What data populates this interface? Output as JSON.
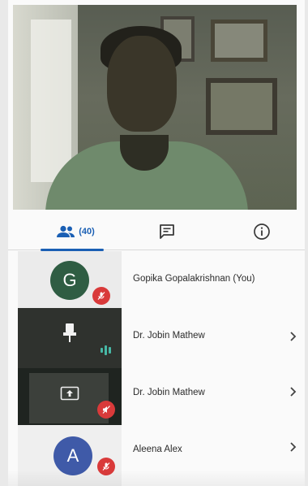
{
  "tabs": {
    "people_count": "(40)",
    "people_icon": "people-icon",
    "chat_icon": "chat-icon",
    "info_icon": "info-icon",
    "accent": "#1a5fb4"
  },
  "participants": [
    {
      "initial": "G",
      "name": "Gopika Gopalakrishnan (You)",
      "muted": true,
      "avatar_color": "#2f5d43"
    },
    {
      "name": "Dr. Jobin Mathew",
      "pinned_tile": true,
      "speaking": true
    },
    {
      "name": "Dr. Jobin Mathew",
      "presenting": true,
      "muted": true
    },
    {
      "initial": "A",
      "name": "Aleena Alex",
      "muted": true,
      "avatar_color": "#3f5aa8"
    }
  ],
  "colors": {
    "mute": "#d93a3a",
    "speaking": "#47b8a6"
  }
}
